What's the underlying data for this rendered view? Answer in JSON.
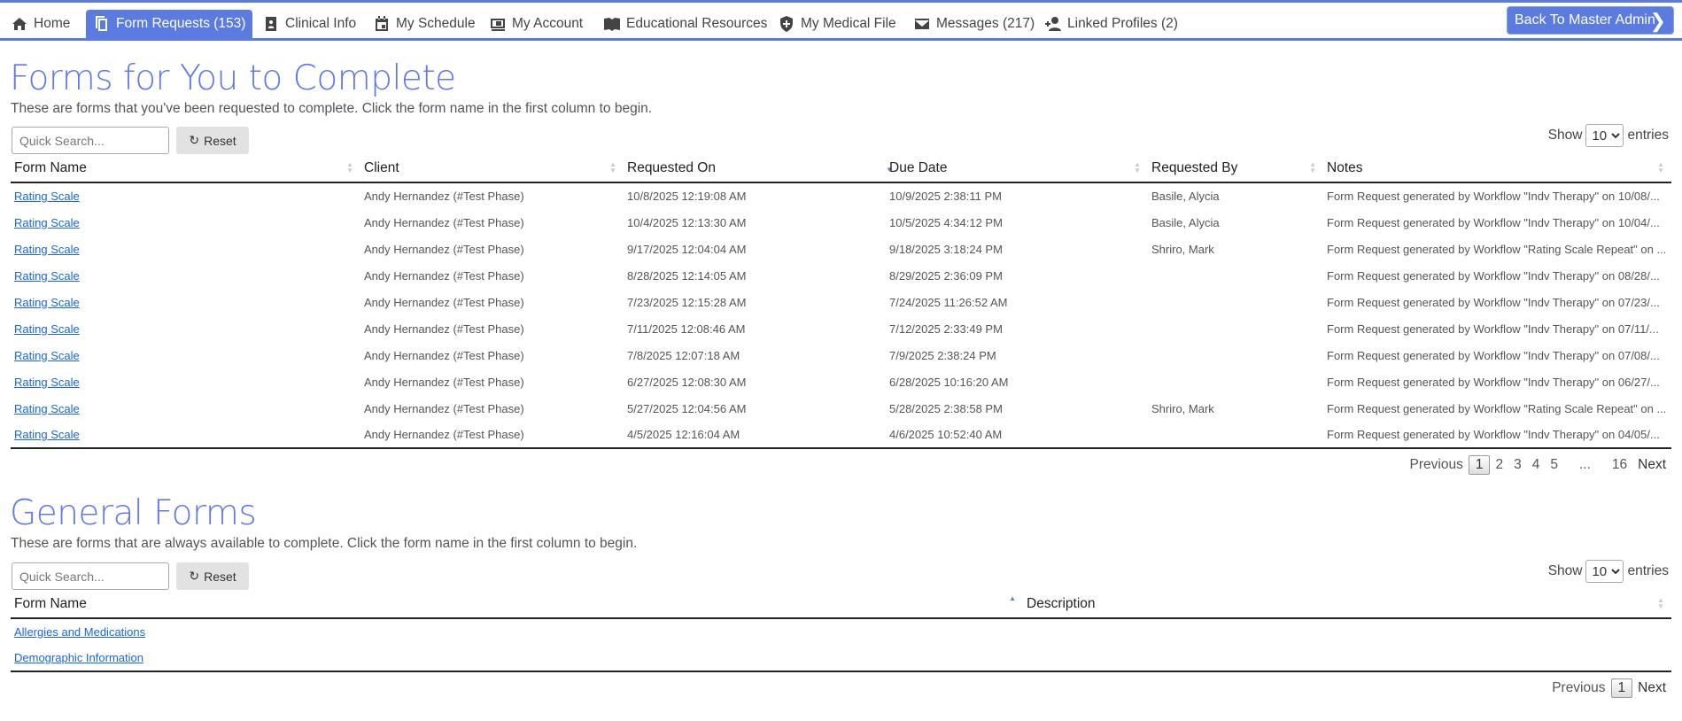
{
  "nav": {
    "items": [
      {
        "label": "Home",
        "icon": "home-icon"
      },
      {
        "label": "Form Requests (153)",
        "icon": "copy-icon",
        "active": true
      },
      {
        "label": "Clinical Info",
        "icon": "badge-icon"
      },
      {
        "label": "My Schedule",
        "icon": "calendar-icon"
      },
      {
        "label": "My Account",
        "icon": "wallet-icon"
      },
      {
        "label": "Educational Resources",
        "icon": "book-icon"
      },
      {
        "label": "My Medical File",
        "icon": "shield-plus-icon"
      },
      {
        "label": "Messages (217)",
        "icon": "mail-icon"
      },
      {
        "label": "Linked Profiles (2)",
        "icon": "person-add-icon"
      }
    ],
    "back_label": "Back To Master Admin"
  },
  "accent": "#5b7be0",
  "requested": {
    "title": "Forms for You to Complete",
    "subtitle": "These are forms that you've been requested to complete. Click the form name in the first column to begin.",
    "search_placeholder": "Quick Search...",
    "reset_label": "Reset",
    "show_label": "Show",
    "show_value": "10",
    "entries_label": "entries",
    "columns": [
      "Form Name",
      "Client",
      "Requested On",
      "Due Date",
      "Requested By",
      "Notes"
    ],
    "rows": [
      [
        "Rating Scale",
        "Andy Hernandez (#Test Phase)",
        "10/8/2025 12:19:08 AM",
        "10/9/2025 2:38:11 PM",
        "Basile, Alycia",
        "Form Request generated by Workflow \"Indv Therapy\" on 10/08/..."
      ],
      [
        "Rating Scale",
        "Andy Hernandez (#Test Phase)",
        "10/4/2025 12:13:30 AM",
        "10/5/2025 4:34:12 PM",
        "Basile, Alycia",
        "Form Request generated by Workflow \"Indv Therapy\" on 10/04/..."
      ],
      [
        "Rating Scale",
        "Andy Hernandez (#Test Phase)",
        "9/17/2025 12:04:04 AM",
        "9/18/2025 3:18:24 PM",
        "Shriro, Mark",
        "Form Request generated by Workflow \"Rating Scale Repeat\" on ..."
      ],
      [
        "Rating Scale",
        "Andy Hernandez (#Test Phase)",
        "8/28/2025 12:14:05 AM",
        "8/29/2025 2:36:09 PM",
        "",
        "Form Request generated by Workflow \"Indv Therapy\" on 08/28/..."
      ],
      [
        "Rating Scale",
        "Andy Hernandez (#Test Phase)",
        "7/23/2025 12:15:28 AM",
        "7/24/2025 11:26:52 AM",
        "",
        "Form Request generated by Workflow \"Indv Therapy\" on 07/23/..."
      ],
      [
        "Rating Scale",
        "Andy Hernandez (#Test Phase)",
        "7/11/2025 12:08:46 AM",
        "7/12/2025 2:33:49 PM",
        "",
        "Form Request generated by Workflow \"Indv Therapy\" on 07/11/..."
      ],
      [
        "Rating Scale",
        "Andy Hernandez (#Test Phase)",
        "7/8/2025 12:07:18 AM",
        "7/9/2025 2:38:24 PM",
        "",
        "Form Request generated by Workflow \"Indv Therapy\" on 07/08/..."
      ],
      [
        "Rating Scale",
        "Andy Hernandez (#Test Phase)",
        "6/27/2025 12:08:30 AM",
        "6/28/2025 10:16:20 AM",
        "",
        "Form Request generated by Workflow \"Indv Therapy\" on 06/27/..."
      ],
      [
        "Rating Scale",
        "Andy Hernandez (#Test Phase)",
        "5/27/2025 12:04:56 AM",
        "5/28/2025 2:38:58 PM",
        "Shriro, Mark",
        "Form Request generated by Workflow \"Rating Scale Repeat\" on ..."
      ],
      [
        "Rating Scale",
        "Andy Hernandez (#Test Phase)",
        "4/5/2025 12:16:04 AM",
        "4/6/2025 10:52:40 AM",
        "",
        "Form Request generated by Workflow \"Indv Therapy\" on 04/05/..."
      ]
    ],
    "pager": {
      "previous": "Previous",
      "pages": [
        "1",
        "2",
        "3",
        "4",
        "5",
        "...",
        "16"
      ],
      "current": "1",
      "next": "Next"
    }
  },
  "general": {
    "title": "General Forms",
    "subtitle": "These are forms that are always available to complete. Click the form name in the first column to begin.",
    "search_placeholder": "Quick Search...",
    "reset_label": "Reset",
    "show_label": "Show",
    "show_value": "10",
    "entries_label": "entries",
    "columns": [
      "Form Name",
      "Description"
    ],
    "rows": [
      [
        "Allergies and Medications",
        ""
      ],
      [
        "Demographic Information",
        ""
      ]
    ],
    "pager": {
      "previous": "Previous",
      "pages": [
        "1"
      ],
      "current": "1",
      "next": "Next"
    }
  }
}
